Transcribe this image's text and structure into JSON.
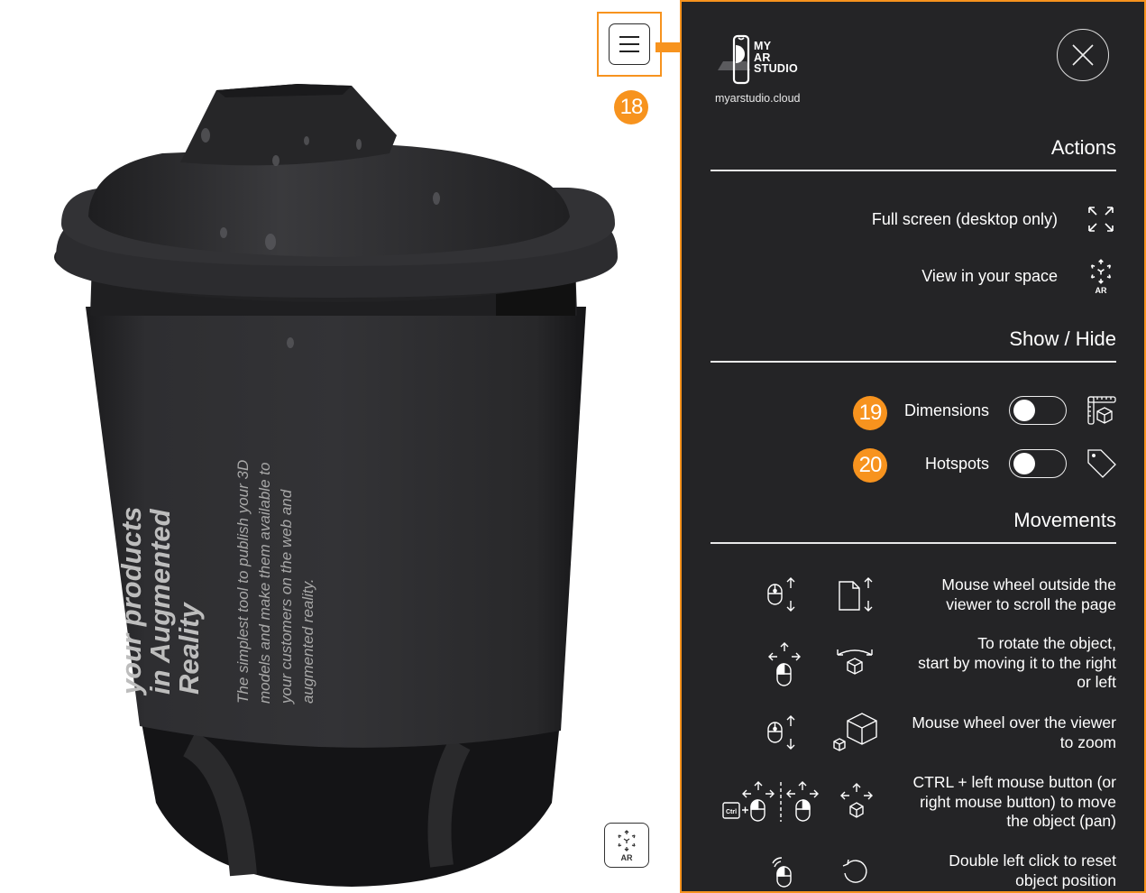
{
  "viewer": {
    "cup_print": {
      "headline_lines": [
        "your products",
        "in Augmented",
        "Reality"
      ],
      "body_lines": [
        "The simplest tool to publish your 3D",
        "models and make them available to",
        "your customers on the web and",
        "augmented reality."
      ]
    },
    "menu_button_icon": "hamburger-icon",
    "ar_button": {
      "icon": "ar-cube-icon",
      "label": "AR"
    },
    "annotation_badges": {
      "menu": "18"
    },
    "accent_color": "#f7931e"
  },
  "panel": {
    "logo": {
      "lines": [
        "MY",
        "AR",
        "STUDIO"
      ],
      "url": "myarstudio.cloud"
    },
    "close_icon": "close-icon",
    "sections": {
      "actions": {
        "title": "Actions",
        "items": [
          {
            "label": "Full screen (desktop only)",
            "icon": "fullscreen-icon"
          },
          {
            "label": "View in your space",
            "icon": "ar-cube-icon",
            "icon_caption": "AR"
          }
        ]
      },
      "show_hide": {
        "title": "Show / Hide",
        "items": [
          {
            "badge": "19",
            "label": "Dimensions",
            "enabled": false,
            "icon": "ruler-cube-icon"
          },
          {
            "badge": "20",
            "label": "Hotspots",
            "enabled": false,
            "icon": "tag-icon"
          }
        ]
      },
      "movements": {
        "title": "Movements",
        "items": [
          {
            "lines": [
              "Mouse wheel outside the",
              "viewer to scroll the page"
            ],
            "icons": [
              "mouse-scroll-icon",
              "page-scroll-icon"
            ]
          },
          {
            "lines": [
              "To rotate the object,",
              "start by moving it to the right",
              "or left"
            ],
            "icons": [
              "mouse-move-icon",
              "rotate-cube-icon"
            ]
          },
          {
            "lines": [
              "Mouse wheel over the viewer",
              "to zoom"
            ],
            "icons": [
              "mouse-scroll-icon",
              "zoom-cubes-icon"
            ]
          },
          {
            "lines": [
              "CTRL + left mouse button (or",
              "right mouse button) to move",
              "the object (pan)"
            ],
            "icons": [
              "ctrl-mouse-pan-icon",
              "right-mouse-pan-icon",
              "pan-cube-icon"
            ],
            "ctrl_key_label": "Ctrl"
          },
          {
            "lines": [
              "Double left click to reset",
              "object position"
            ],
            "icons": [
              "double-click-icon",
              "reset-icon"
            ]
          }
        ]
      }
    }
  }
}
